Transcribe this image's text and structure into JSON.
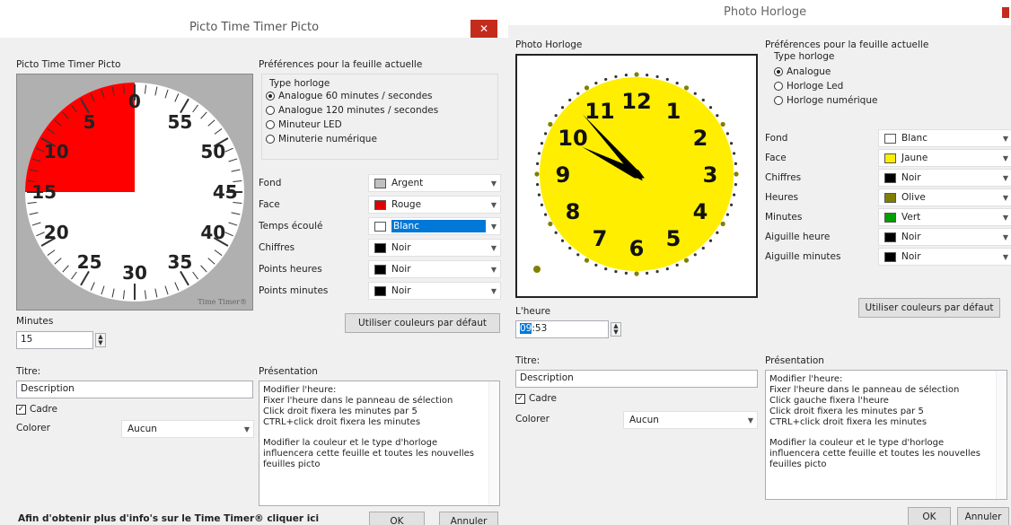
{
  "d1": {
    "title": "Picto Time Timer Picto",
    "close": "✕",
    "section": "Picto Time Timer Picto",
    "dial_numbers": [
      "0",
      "55",
      "50",
      "45",
      "40",
      "35",
      "30",
      "25",
      "20",
      "15",
      "10",
      "5"
    ],
    "brand": "Time Timer®",
    "elapsed_minutes": 15,
    "prefs_title": "Préférences pour la feuille actuelle",
    "type_label": "Type horloge",
    "types": [
      {
        "label": "Analogue 60 minutes / secondes",
        "selected": true
      },
      {
        "label": "Analogue 120 minutes / secondes",
        "selected": false
      },
      {
        "label": "Minuteur LED",
        "selected": false
      },
      {
        "label": "Minuterie numérique",
        "selected": false
      }
    ],
    "colors": [
      {
        "label": "Fond",
        "value": "Argent",
        "swatch": "#c0c0c0"
      },
      {
        "label": "Face",
        "value": "Rouge",
        "swatch": "#e00000"
      },
      {
        "label": "Temps écoulé",
        "value": "Blanc",
        "swatch": "#ffffff",
        "highlight": true
      },
      {
        "label": "Chiffres",
        "value": "Noir",
        "swatch": "#000000"
      },
      {
        "label": "Points heures",
        "value": "Noir",
        "swatch": "#000000"
      },
      {
        "label": "Points minutes",
        "value": "Noir",
        "swatch": "#000000"
      }
    ],
    "default_btn": "Utiliser couleurs par défaut",
    "minutes_label": "Minutes",
    "minutes_value": "15",
    "titre_label": "Titre:",
    "titre_value": "Description",
    "cadre_label": "Cadre",
    "colorer_label": "Colorer",
    "colorer_value": "Aucun",
    "pres_label": "Présentation",
    "pres_lines": [
      "Modifier l'heure:\nFixer l'heure dans le panneau de sélection\nClick droit fixera les minutes par 5\nCTRL+click droit fixera les minutes",
      "Modifier la couleur et le type d'horloge\ninfluencera cette feuille et toutes les nouvelles\nfeuilles picto"
    ],
    "info_link": "Afin d'obtenir plus d'info's sur le Time Timer® cliquer ici",
    "ok": "OK",
    "cancel": "Annuler"
  },
  "d2": {
    "title": "Photo Horloge",
    "section": "Photo Horloge",
    "hours": [
      "12",
      "1",
      "2",
      "3",
      "4",
      "5",
      "6",
      "7",
      "8",
      "9",
      "10",
      "11"
    ],
    "time": {
      "hour": 9,
      "minute": 53
    },
    "prefs_title": "Préférences pour la feuille actuelle",
    "type_label": "Type horloge",
    "types": [
      {
        "label": "Analogue",
        "selected": true
      },
      {
        "label": "Horloge Led",
        "selected": false
      },
      {
        "label": "Horloge numérique",
        "selected": false
      }
    ],
    "colors": [
      {
        "label": "Fond",
        "value": "Blanc",
        "swatch": "#ffffff"
      },
      {
        "label": "Face",
        "value": "Jaune",
        "swatch": "#ffee00"
      },
      {
        "label": "Chiffres",
        "value": "Noir",
        "swatch": "#000000"
      },
      {
        "label": "Heures",
        "value": "Olive",
        "swatch": "#808000"
      },
      {
        "label": "Minutes",
        "value": "Vert",
        "swatch": "#00a000"
      },
      {
        "label": "Aiguille heure",
        "value": "Noir",
        "swatch": "#000000"
      },
      {
        "label": "Aiguille minutes",
        "value": "Noir",
        "swatch": "#000000"
      }
    ],
    "default_btn": "Utiliser couleurs par défaut",
    "heure_label": "L'heure",
    "heure_sel": "09",
    "heure_rest": ":53",
    "titre_label": "Titre:",
    "titre_value": "Description",
    "cadre_label": "Cadre",
    "colorer_label": "Colorer",
    "colorer_value": "Aucun",
    "pres_label": "Présentation",
    "pres_lines": [
      "Modifier l'heure:\nFixer l'heure dans le panneau de sélection\nClick gauche fixera l'heure\nClick droit fixera les minutes par 5\nCTRL+click droit fixera les minutes",
      "Modifier la couleur et le type d'horloge\ninfluencera cette feuille et toutes les nouvelles\nfeuilles picto"
    ],
    "ok": "OK",
    "cancel": "Annuler"
  }
}
